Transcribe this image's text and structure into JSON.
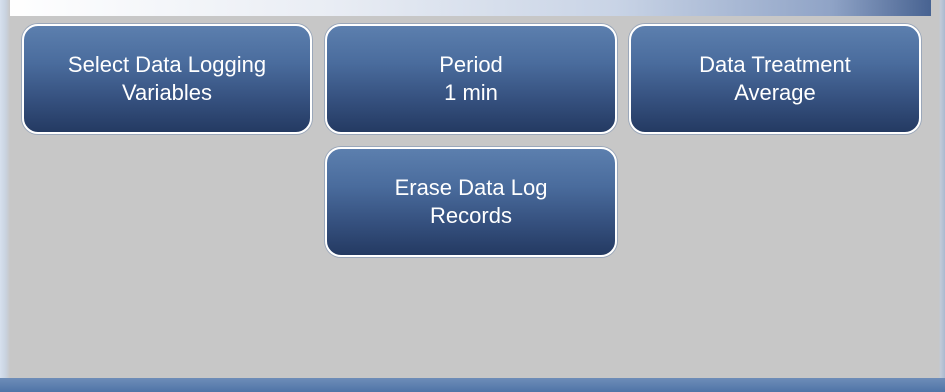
{
  "buttons": {
    "select_variables": {
      "line1": "Select Data Logging",
      "line2": "Variables"
    },
    "period": {
      "line1": "Period",
      "line2": "1 min"
    },
    "data_treatment": {
      "line1": "Data Treatment",
      "line2": "Average"
    },
    "erase_records": {
      "line1": "Erase Data Log",
      "line2": "Records"
    }
  },
  "colors": {
    "background": "#c7c7c7",
    "button_top": "#5c7fae",
    "button_bottom": "#243a62",
    "bottom_bar": "#4f74a7"
  }
}
